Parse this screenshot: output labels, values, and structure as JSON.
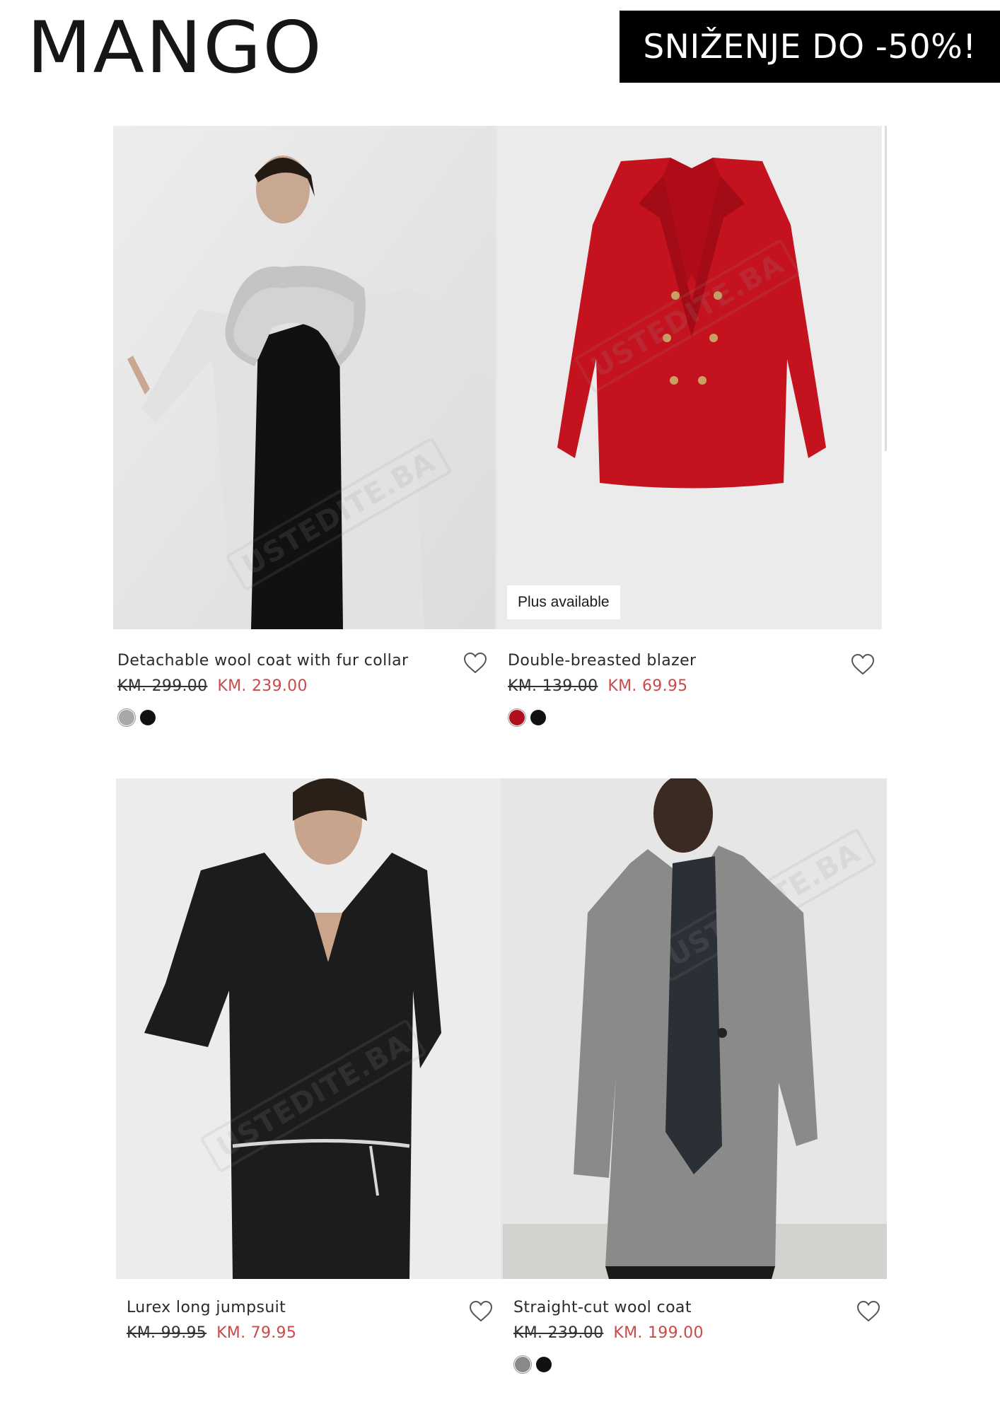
{
  "header": {
    "brand": "MANGO",
    "promo_text": "SNIŽENJE DO -50%!"
  },
  "watermark": "USTEDITE.BA",
  "products": [
    {
      "name": "Detachable wool coat with fur collar",
      "old_price": "KM. 299.00",
      "new_price": "KM. 239.00",
      "colors": [
        "#a8a8a8",
        "#111111"
      ],
      "badge": ""
    },
    {
      "name": "Double-breasted blazer",
      "old_price": "KM. 139.00",
      "new_price": "KM. 69.95",
      "colors": [
        "#b0101e",
        "#111111"
      ],
      "badge": "Plus available"
    },
    {
      "name": "Lurex long jumpsuit",
      "old_price": "KM. 99.95",
      "new_price": "KM. 79.95",
      "colors": [],
      "badge": ""
    },
    {
      "name": "Straight-cut wool coat",
      "old_price": "KM. 239.00",
      "new_price": "KM. 199.00",
      "colors": [
        "#8a8a8a",
        "#111111"
      ],
      "badge": ""
    }
  ],
  "icons": {
    "wishlist": "heart-outline-icon"
  }
}
